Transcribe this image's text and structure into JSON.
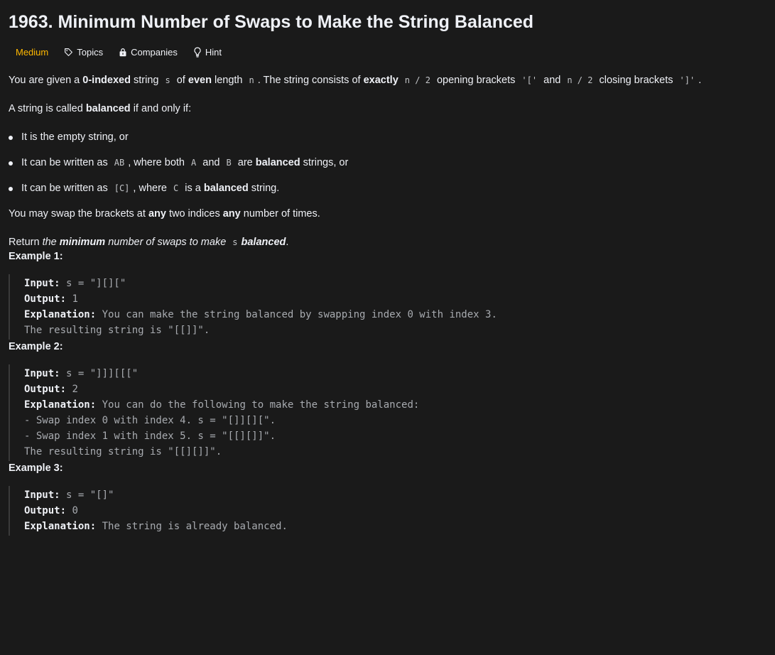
{
  "problem": {
    "title": "1963. Minimum Number of Swaps to Make the String Balanced"
  },
  "tags": {
    "difficulty": "Medium",
    "topics": "Topics",
    "companies": "Companies",
    "hint": "Hint"
  },
  "description": {
    "p1": {
      "t1": "You are given a ",
      "b1": "0-indexed",
      "t2": " string ",
      "c1": "s",
      "t3": " of ",
      "b2": "even",
      "t4": " length ",
      "c2": "n",
      "t5": ". The string consists of ",
      "b3": "exactly",
      "t6": " ",
      "c3": "n / 2",
      "t7": " opening brackets ",
      "c4": "'['",
      "t8": " and ",
      "c5": "n / 2",
      "t9": " closing brackets ",
      "c6": "']'",
      "t10": "."
    },
    "p2": {
      "t1": "A string is called ",
      "b1": "balanced",
      "t2": " if and only if:"
    },
    "bullets": {
      "b0": "It is the empty string, or",
      "b1_t1": "It can be written as ",
      "b1_c1": "AB",
      "b1_t2": ", where both ",
      "b1_c2": "A",
      "b1_t3": " and ",
      "b1_c3": "B",
      "b1_t4": " are ",
      "b1_b": "balanced",
      "b1_t5": " strings, or",
      "b2_t1": "It can be written as ",
      "b2_c1": "[C]",
      "b2_t2": ", where ",
      "b2_c2": "C",
      "b2_t3": " is a ",
      "b2_b": "balanced",
      "b2_t4": " string."
    },
    "p3": {
      "t1": "You may swap the brackets at ",
      "b1": "any",
      "t2": " two indices ",
      "b2": "any",
      "t3": " number of times."
    },
    "p4": {
      "t1": "Return ",
      "i1": "the ",
      "ib1": "minimum",
      "i2": " number of swaps to make ",
      "c1": "s",
      "ib2": "balanced",
      "t2": "."
    }
  },
  "examples": [
    {
      "title": "Example 1:",
      "input_label": "Input:",
      "input_value": " s = \"][][\"",
      "output_label": "Output:",
      "output_value": " 1",
      "explanation_label": "Explanation:",
      "explanation_lines": [
        " You can make the string balanced by swapping index 0 with index 3.",
        "The resulting string is \"[[]]\"."
      ]
    },
    {
      "title": "Example 2:",
      "input_label": "Input:",
      "input_value": " s = \"]]][[[\"",
      "output_label": "Output:",
      "output_value": " 2",
      "explanation_label": "Explanation:",
      "explanation_lines": [
        " You can do the following to make the string balanced:",
        "- Swap index 0 with index 4. s = \"[]][][\".",
        "- Swap index 1 with index 5. s = \"[[][]]\".",
        "The resulting string is \"[[][]]\"."
      ]
    },
    {
      "title": "Example 3:",
      "input_label": "Input:",
      "input_value": " s = \"[]\"",
      "output_label": "Output:",
      "output_value": " 0",
      "explanation_label": "Explanation:",
      "explanation_lines": [
        " The string is already balanced."
      ]
    }
  ],
  "colors": {
    "background": "#1a1a1a",
    "text": "#eff1f6",
    "difficulty_medium": "#ffb800",
    "code_text": "#a8abb0"
  },
  "icons": {
    "topics": "tag-icon",
    "companies": "lock-icon",
    "hint": "lightbulb-icon"
  }
}
